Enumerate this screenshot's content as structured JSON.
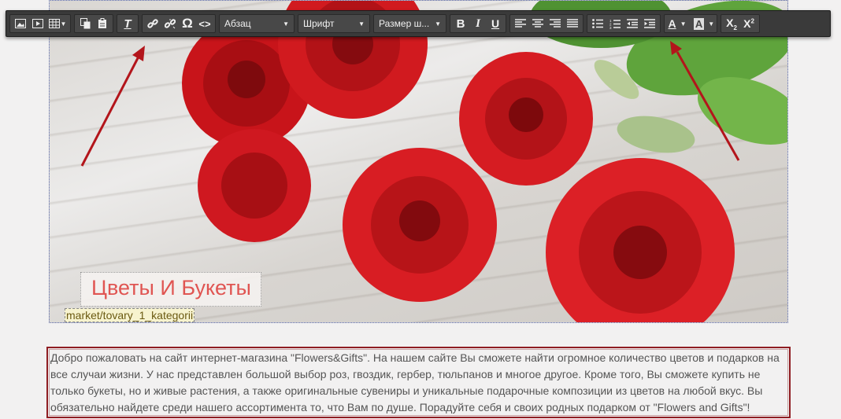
{
  "toolbar": {
    "buttons_left": [
      {
        "name": "image-icon",
        "glyph": "image"
      },
      {
        "name": "media-icon",
        "glyph": "media"
      },
      {
        "name": "table-icon",
        "glyph": "table"
      }
    ],
    "paragraph_format": "Абзац",
    "font_family": "Шрифт",
    "font_size": "Размер ш...",
    "bold": "B",
    "italic": "I",
    "underline": "U",
    "font_color": "A",
    "bg_color": "A",
    "subscript": "X",
    "superscript": "X",
    "sub_mark": "2",
    "sup_mark": "2",
    "special_char": "Ω",
    "code": "<>",
    "clear_format": "T"
  },
  "hero": {
    "title": "Цветы И Букеты",
    "url_tag": "market/tovary_1_kategorii"
  },
  "content": {
    "paragraph": "Добро пожаловать на сайт интернет-магазина \"Flowers&Gifts\". На нашем сайте Вы сможете найти огромное количество цветов и подарков на все случаи жизни. У нас представлен большой выбор роз, гвоздик, гербер, тюльпанов и многое другое. Кроме того, Вы сможете купить не только букеты, но и живые растения, а также оригинальные сувениры и уникальные подарочные композиции из цветов на любой вкус. Вы обязательно найдете среди нашего ассортимента то, что Вам по душе. Порадуйте себя и своих родных подарком от \"Flowers and Gifts\"!"
  },
  "colors": {
    "toolbar_bg": "#3a3a3a",
    "rose": "#d11a1f",
    "arrow": "#b3151b",
    "title_text": "#e05552",
    "paragraph_border": "#8f1d22"
  }
}
